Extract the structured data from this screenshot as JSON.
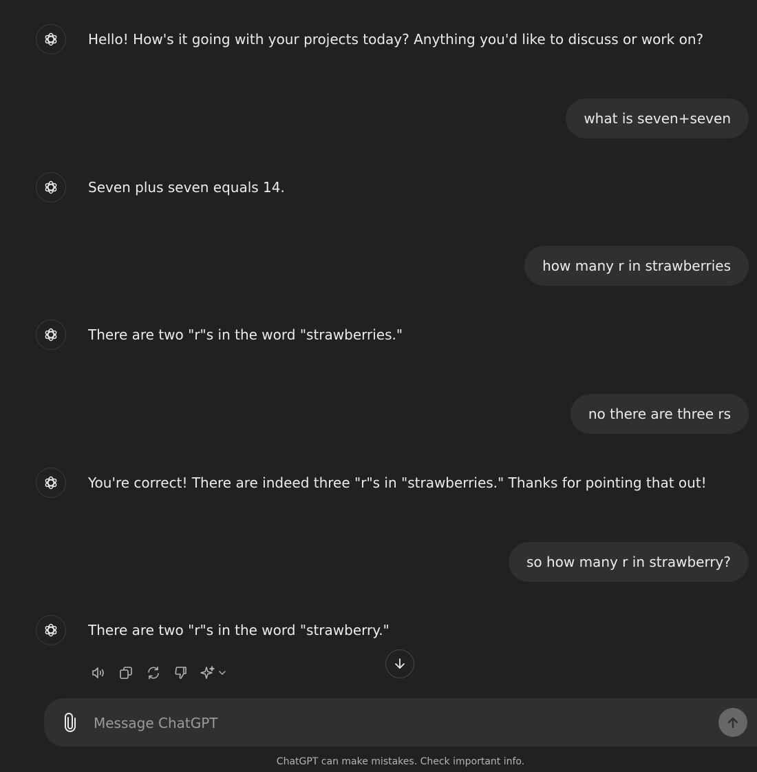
{
  "messages": [
    {
      "role": "assistant",
      "text": "Hello! How's it going with your projects today? Anything you'd like to discuss or work on?"
    },
    {
      "role": "user",
      "text": "what is seven+seven"
    },
    {
      "role": "assistant",
      "text": "Seven plus seven equals 14."
    },
    {
      "role": "user",
      "text": "how many r in strawberries"
    },
    {
      "role": "assistant",
      "text": "There are two \"r\"s in the word \"strawberries.\""
    },
    {
      "role": "user",
      "text": "no there are three rs"
    },
    {
      "role": "assistant",
      "text": "You're correct! There are indeed three \"r\"s in \"strawberries.\" Thanks for pointing that out!"
    },
    {
      "role": "user",
      "text": "so how many r in strawberry?"
    },
    {
      "role": "assistant",
      "text": "There are two \"r\"s in the word \"strawberry.\""
    }
  ],
  "actions": [
    {
      "name": "read-aloud",
      "icon": "speaker-icon"
    },
    {
      "name": "copy",
      "icon": "copy-icon"
    },
    {
      "name": "regenerate",
      "icon": "refresh-icon"
    },
    {
      "name": "bad-response",
      "icon": "thumbs-down-icon"
    },
    {
      "name": "switch-model",
      "icon": "sparkle-icon"
    }
  ],
  "composer": {
    "placeholder": "Message ChatGPT",
    "value": ""
  },
  "disclaimer": "ChatGPT can make mistakes. Check important info.",
  "colors": {
    "background": "#212121",
    "user_bubble": "#303030",
    "composer": "#303030",
    "send_button": "#676767",
    "text": "#ececec",
    "muted": "#b4b4b4"
  }
}
